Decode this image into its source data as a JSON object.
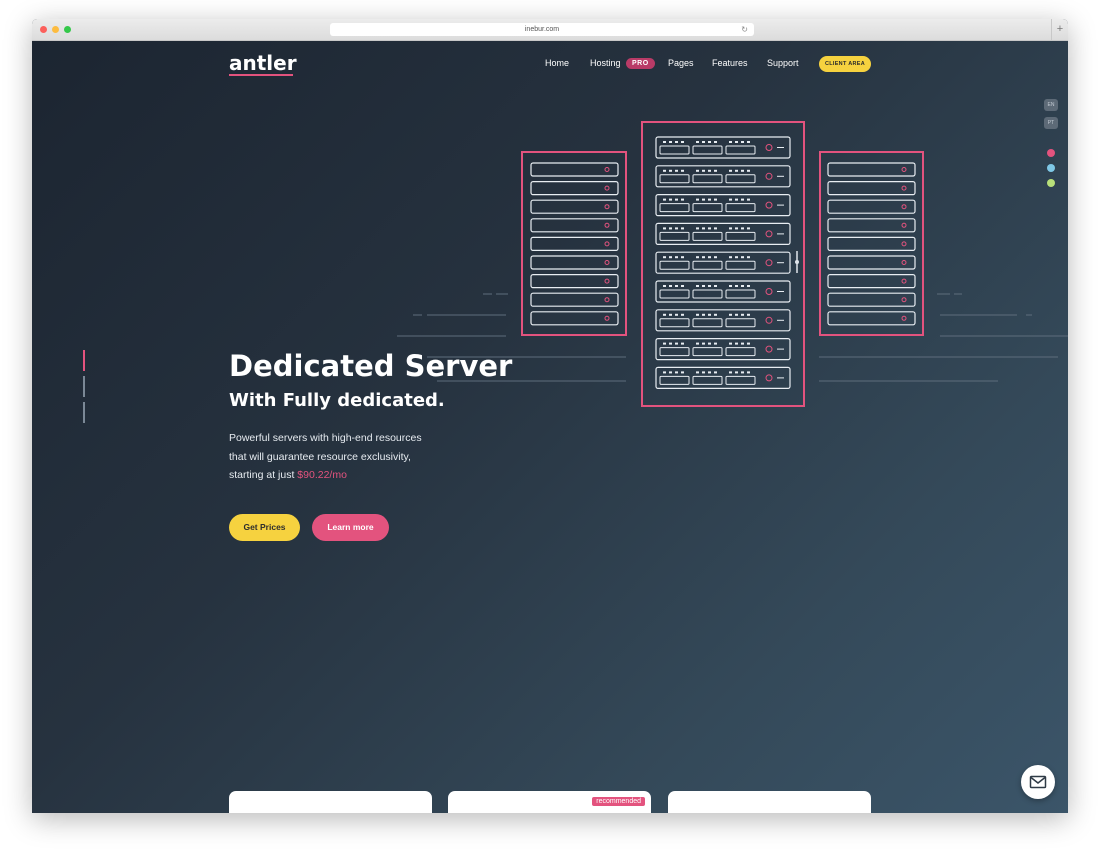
{
  "browser": {
    "url": "inebur.com",
    "new_tab": "+",
    "reload": "↻"
  },
  "site": {
    "logo": "antler",
    "nav": {
      "home": "Home",
      "hosting": "Hosting",
      "pro_badge": "PRO",
      "pages": "Pages",
      "features": "Features",
      "support": "Support",
      "client_area": "CLIENT AREA"
    },
    "languages": [
      "EN",
      "PT"
    ],
    "theme_colors": [
      "#e3537e",
      "#7fc8e6",
      "#b8e07a"
    ],
    "accent_color": "#e3537e",
    "button_color": "#f6d23f"
  },
  "hero": {
    "title": "Dedicated Server",
    "subtitle": "With Fully dedicated.",
    "desc_line1": "Powerful servers with high-end resources",
    "desc_line2": "that will guarantee resource exclusivity,",
    "desc_line3_prefix": "starting at just",
    "price": "$90.22/mo",
    "btn_primary": "Get Prices",
    "btn_secondary": "Learn more"
  },
  "cards": {
    "badge": "recommended",
    "icons": [
      "cloud-icon",
      "server-icon",
      "server-rack-icon"
    ]
  },
  "icons": {
    "mail": "mail-icon",
    "server_illustration": "server-racks-illustration"
  }
}
